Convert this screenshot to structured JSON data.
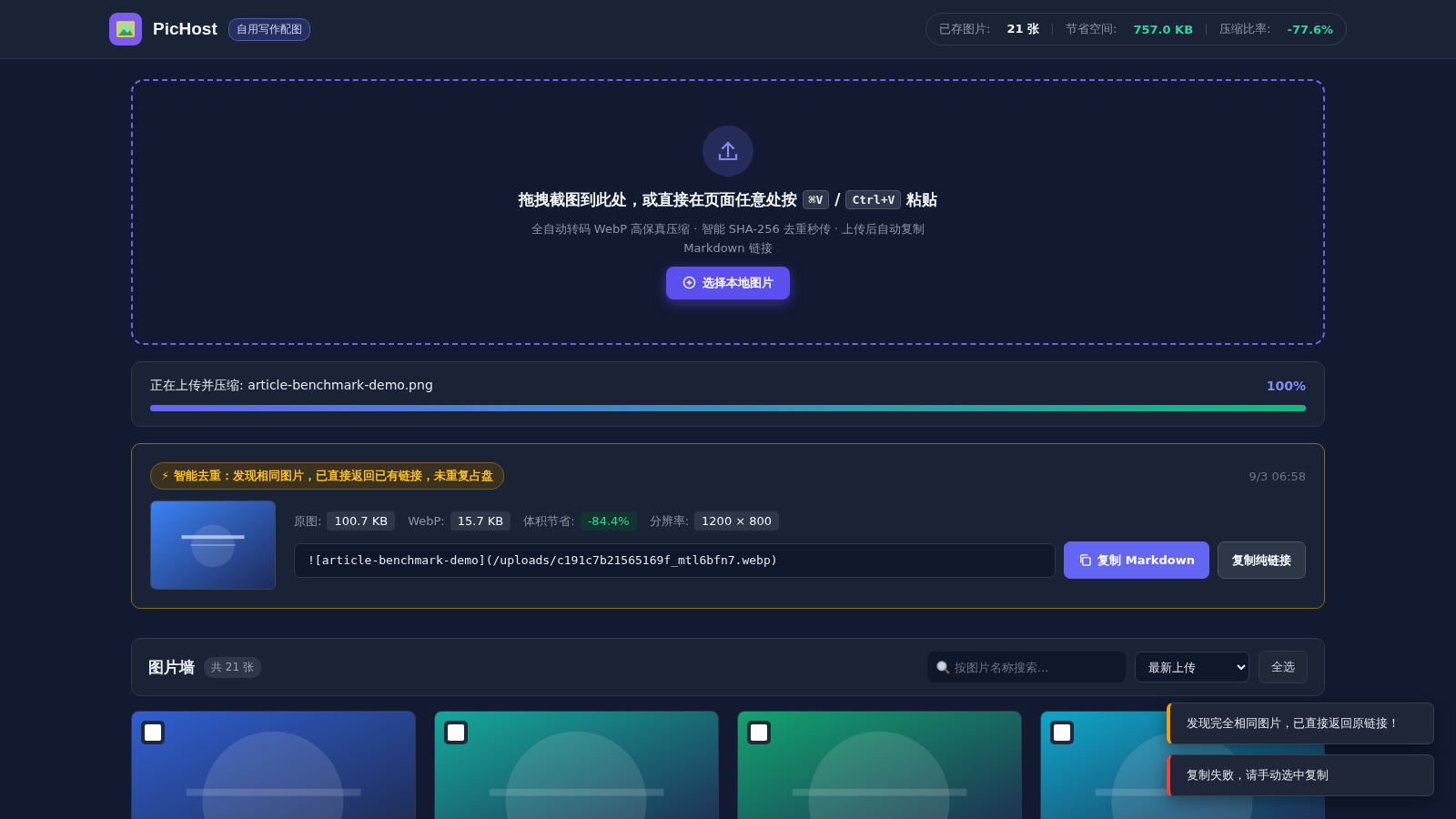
{
  "header": {
    "brand": "PicHost",
    "tag": "自用写作配图",
    "stats": [
      {
        "label": "已存图片:",
        "value": "21 张",
        "highlighted": false
      },
      {
        "label": "节省空间:",
        "value": "757.0 KB",
        "highlighted": true
      },
      {
        "label": "压缩比率:",
        "value": "-77.6%",
        "highlighted": true
      }
    ]
  },
  "upload": {
    "title_before": "拖拽截图到此处，或直接在页面任意处按",
    "keys": [
      "⌘V",
      "Ctrl+V"
    ],
    "separator": "/",
    "title_after": "粘贴",
    "subtitle": "全自动转码 WebP 高保真压缩 · 智能 SHA-256 去重秒传 · 上传后自动复制 Markdown 链接",
    "button": "选择本地图片"
  },
  "progress": {
    "label": "正在上传并压缩: article-benchmark-demo.png",
    "percent": "100%",
    "level": 1
  },
  "result": {
    "notice": "⚡ 智能去重：发现相同图片，已直接返回已有链接，未重复占盘",
    "time": "9/3 06:58",
    "meta": [
      {
        "label": "原图:",
        "value": "100.7 KB",
        "highlighted": false
      },
      {
        "label": "WebP:",
        "value": "15.7 KB",
        "highlighted": false
      },
      {
        "label": "体积节省:",
        "value": "-84.4%",
        "highlighted": true
      },
      {
        "label": "分辨率:",
        "value": "1200 × 800",
        "highlighted": false
      }
    ],
    "markdown": "![article-benchmark-demo](/uploads/c191c7b21565169f_mtl6bfn7.webp)",
    "copy_markdown": "复制 Markdown",
    "copy_link": "复制纯链接"
  },
  "gallery": {
    "title": "图片墙",
    "count": "共 21 张",
    "search_placeholder": "按图片名称搜索...",
    "sort": "最新上传",
    "select_all": "全选",
    "images": [
      {
        "checked": false,
        "color": "#2f5fd0"
      },
      {
        "checked": false,
        "color": "#15a89a"
      },
      {
        "checked": false,
        "color": "#12a36f"
      },
      {
        "checked": false,
        "color": "#0fa6c8"
      }
    ]
  },
  "toasts": [
    {
      "text": "发现完全相同图片，已直接返回原链接！",
      "kind": "warning"
    },
    {
      "text": "复制失败，请手动选中复制",
      "kind": "error"
    }
  ]
}
